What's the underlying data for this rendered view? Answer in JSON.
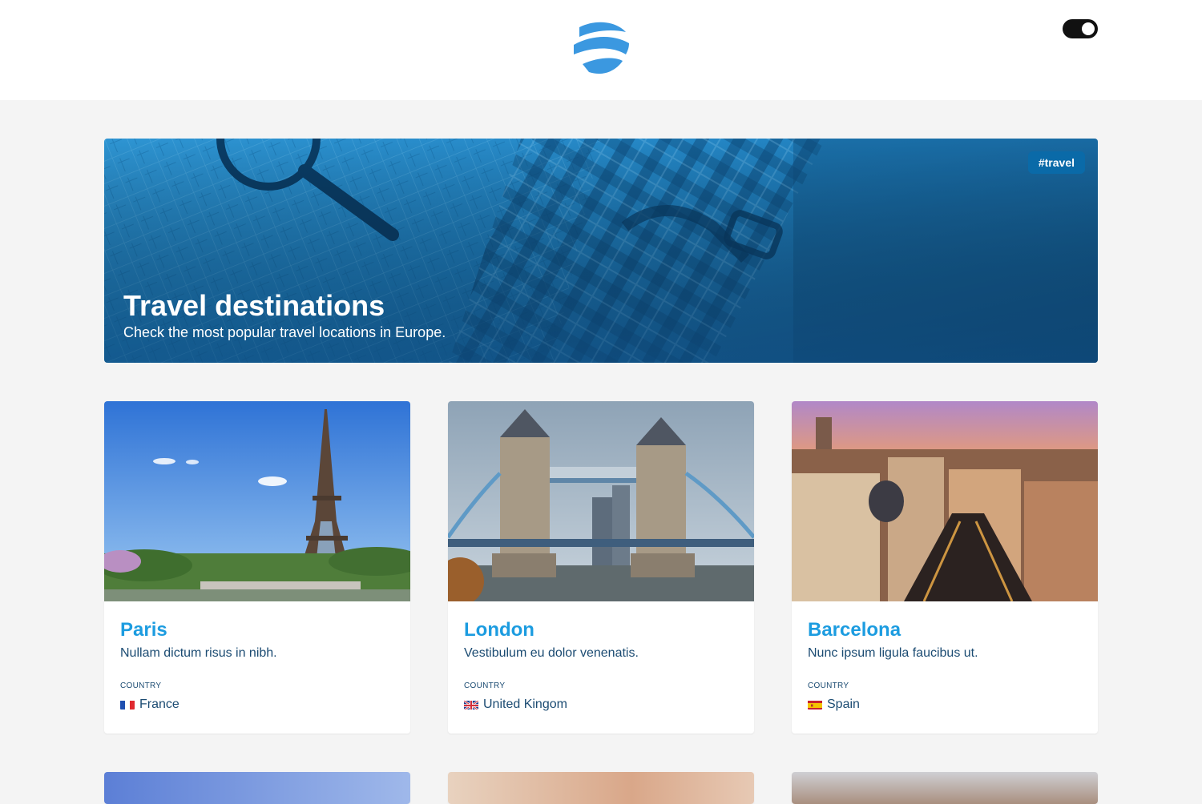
{
  "header": {
    "logo_icon": "globe-waves-logo-icon",
    "theme_toggle_icon": "dark-mode-toggle-icon"
  },
  "hero": {
    "tag": "#travel",
    "title": "Travel destinations",
    "subtitle": "Check the most popular travel locations in Europe."
  },
  "cards": [
    {
      "title": "Paris",
      "description": "Nullam dictum risus in nibh.",
      "country_label": "COUNTRY",
      "country": "France",
      "flag_icon": "france-flag-icon"
    },
    {
      "title": "London",
      "description": "Vestibulum eu dolor venenatis.",
      "country_label": "COUNTRY",
      "country": "United Kingom",
      "flag_icon": "uk-flag-icon"
    },
    {
      "title": "Barcelona",
      "description": "Nunc ipsum ligula faucibus ut.",
      "country_label": "COUNTRY",
      "country": "Spain",
      "flag_icon": "spain-flag-icon"
    }
  ],
  "colors": {
    "accent": "#1c9ce0",
    "text": "#1b4b72",
    "tag_bg": "#0a6aa8",
    "page_bg": "#f4f4f4"
  }
}
